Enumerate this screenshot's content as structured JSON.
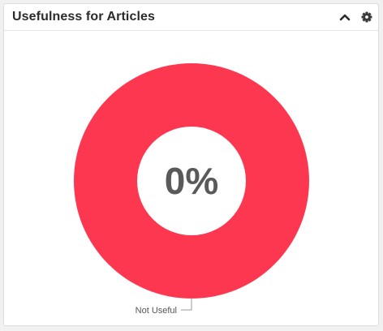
{
  "widget": {
    "title": "Usefulness for Articles",
    "collapse_icon": "chevron-up-icon",
    "settings_icon": "gear-icon"
  },
  "chart_data": {
    "type": "pie",
    "style": "donut",
    "center_label": "0%",
    "slices": [
      {
        "label": "Not Useful",
        "value": 100,
        "color": "#fe3750"
      }
    ],
    "label_text": "Not Useful"
  }
}
